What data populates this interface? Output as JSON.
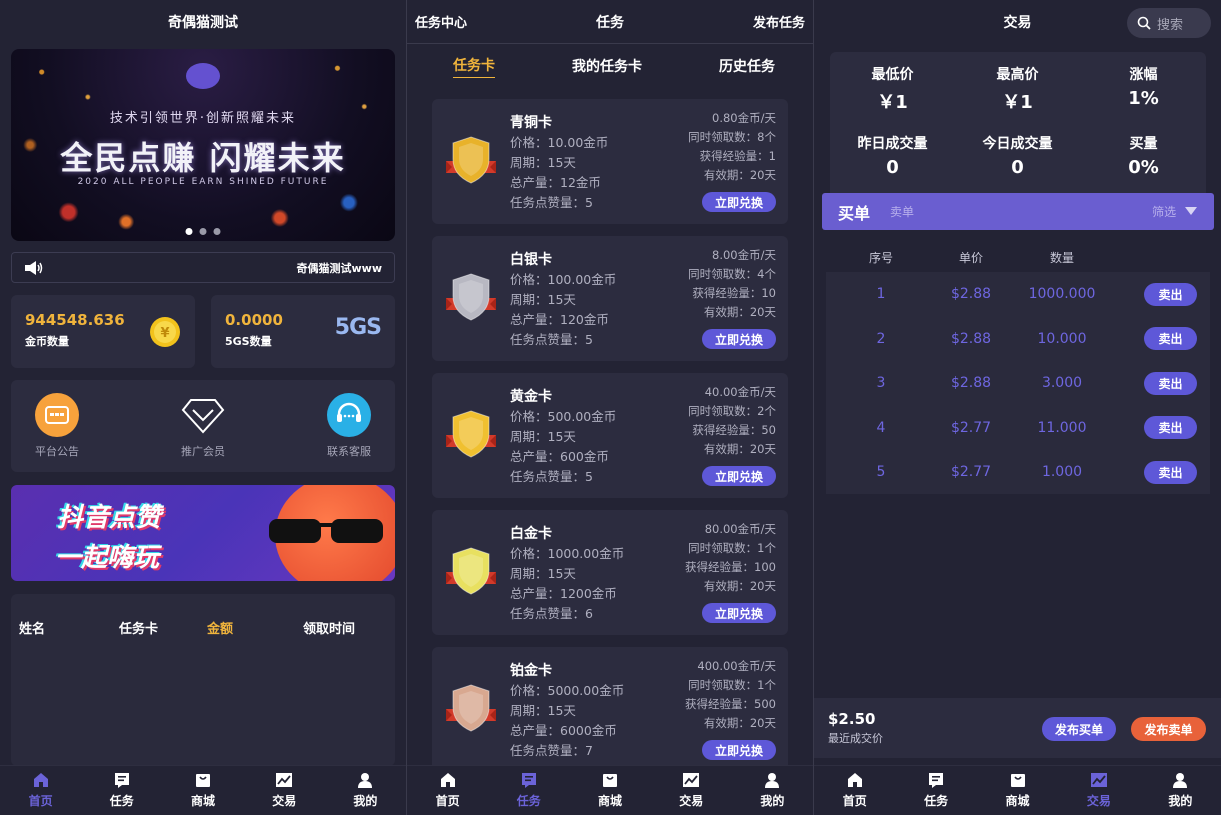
{
  "screen1": {
    "title": "奇偶猫测试",
    "banner": {
      "subtitle": "技术引领世界·创新照耀未来",
      "headline": "全民点赚  闪耀未来",
      "english": "2020 ALL PEOPLE EARN   SHINED FUTURE"
    },
    "notice_text": "奇偶猫测试www",
    "balances": [
      {
        "value": "944548.636",
        "label": "金币数量",
        "icon": "gold-coin-icon"
      },
      {
        "value": "0.0000",
        "label": "5GS数量",
        "icon": "5gs-logo"
      }
    ],
    "logo_5gs": "5GS",
    "quick_links": [
      {
        "label": "平台公告",
        "icon": "announcement-icon"
      },
      {
        "label": "推广会员",
        "icon": "diamond-icon"
      },
      {
        "label": "联系客服",
        "icon": "customer-service-icon"
      }
    ],
    "ad": {
      "line1": "抖音点赞",
      "line2": "一起嗨玩"
    },
    "record_headers": [
      "姓名",
      "任务卡",
      "金额",
      "领取时间"
    ]
  },
  "screen2": {
    "header_left": "任务中心",
    "header_title": "任务",
    "header_right": "发布任务",
    "subtabs": [
      "任务卡",
      "我的任务卡",
      "历史任务"
    ],
    "cards": [
      {
        "name": "青铜卡",
        "price": "价格：10.00金币",
        "period": "周期：15天",
        "output": "总产量：12金币",
        "likes": "任务点赞量：5",
        "rate": "0.80金币/天",
        "daily": "同时领取数：8个",
        "exp": "获得经验量：1",
        "valid": "有效期：20天",
        "btn": "立即兑换",
        "color": "#e8b22a"
      },
      {
        "name": "白银卡",
        "price": "价格：100.00金币",
        "period": "周期：15天",
        "output": "总产量：120金币",
        "likes": "任务点赞量：5",
        "rate": "8.00金币/天",
        "daily": "同时领取数：4个",
        "exp": "获得经验量：10",
        "valid": "有效期：20天",
        "btn": "立即兑换",
        "color": "#b8b8c2"
      },
      {
        "name": "黄金卡",
        "price": "价格：500.00金币",
        "period": "周期：15天",
        "output": "总产量：600金币",
        "likes": "任务点赞量：5",
        "rate": "40.00金币/天",
        "daily": "同时领取数：2个",
        "exp": "获得经验量：50",
        "valid": "有效期：20天",
        "btn": "立即兑换",
        "color": "#f0c030"
      },
      {
        "name": "白金卡",
        "price": "价格：1000.00金币",
        "period": "周期：15天",
        "output": "总产量：1200金币",
        "likes": "任务点赞量：6",
        "rate": "80.00金币/天",
        "daily": "同时领取数：1个",
        "exp": "获得经验量：100",
        "valid": "有效期：20天",
        "btn": "立即兑换",
        "color": "#e8e060"
      },
      {
        "name": "铂金卡",
        "price": "价格：5000.00金币",
        "period": "周期：15天",
        "output": "总产量：6000金币",
        "likes": "任务点赞量：7",
        "rate": "400.00金币/天",
        "daily": "同时领取数：1个",
        "exp": "获得经验量：500",
        "valid": "有效期：20天",
        "btn": "立即兑换",
        "color": "#d8a890"
      }
    ]
  },
  "screen3": {
    "title": "交易",
    "search_placeholder": "搜索",
    "stats": [
      {
        "label": "最低价",
        "value": "￥1"
      },
      {
        "label": "最高价",
        "value": "￥1"
      },
      {
        "label": "涨幅",
        "value": "1%"
      },
      {
        "label": "昨日成交量",
        "value": "0"
      },
      {
        "label": "今日成交量",
        "value": "0"
      },
      {
        "label": "买量",
        "value": "0%"
      }
    ],
    "buy_tab": "买单",
    "sell_tab": "卖单",
    "filter": "筛选",
    "table_headers": [
      "序号",
      "单价",
      "数量"
    ],
    "orders": [
      {
        "no": "1",
        "price": "$2.88",
        "qty": "1000.000",
        "btn": "卖出"
      },
      {
        "no": "2",
        "price": "$2.88",
        "qty": "10.000",
        "btn": "卖出"
      },
      {
        "no": "3",
        "price": "$2.88",
        "qty": "3.000",
        "btn": "卖出"
      },
      {
        "no": "4",
        "price": "$2.77",
        "qty": "11.000",
        "btn": "卖出"
      },
      {
        "no": "5",
        "price": "$2.77",
        "qty": "1.000",
        "btn": "卖出"
      }
    ],
    "last_price": "$2.50",
    "last_price_label": "最近成交价",
    "publish_buy": "发布买单",
    "publish_sell": "发布卖单"
  },
  "tabbar": [
    {
      "label": "首页",
      "icon": "home-icon"
    },
    {
      "label": "任务",
      "icon": "task-icon"
    },
    {
      "label": "商城",
      "icon": "shop-icon"
    },
    {
      "label": "交易",
      "icon": "trade-icon"
    },
    {
      "label": "我的",
      "icon": "profile-icon"
    }
  ],
  "colors": {
    "accent": "#6b63d8",
    "gold": "#f0b43c",
    "sell_orange": "#e8623a",
    "panel": "#2c2c3f",
    "bg": "#232334"
  }
}
